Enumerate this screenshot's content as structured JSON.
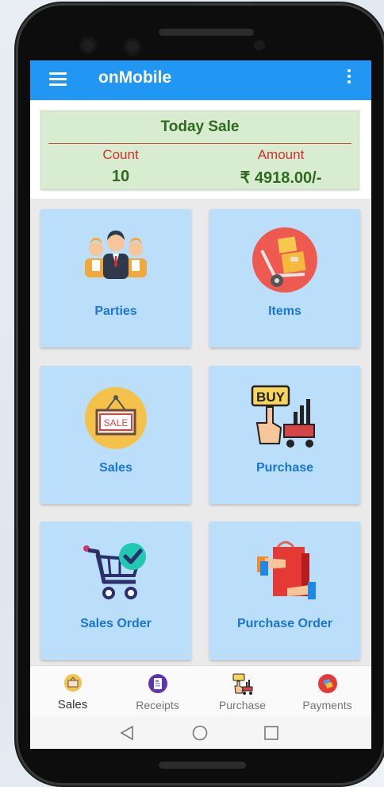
{
  "app": {
    "title": "onMobile",
    "primary_color": "#2196f3"
  },
  "summary": {
    "title": "Today Sale",
    "count_label": "Count",
    "amount_label": "Amount",
    "count_value": "10",
    "amount_value": "₹ 4918.00/-"
  },
  "tiles": [
    {
      "label": "Parties",
      "icon": "parties-icon"
    },
    {
      "label": "Items",
      "icon": "items-icon"
    },
    {
      "label": "Sales",
      "icon": "sales-icon"
    },
    {
      "label": "Purchase",
      "icon": "purchase-icon"
    },
    {
      "label": "Sales Order",
      "icon": "sales-order-icon"
    },
    {
      "label": "Purchase Order",
      "icon": "purchase-order-icon"
    }
  ],
  "bottom_nav": [
    {
      "label": "Sales",
      "active": true
    },
    {
      "label": "Receipts",
      "active": false
    },
    {
      "label": "Purchase",
      "active": false
    },
    {
      "label": "Payments",
      "active": false
    }
  ],
  "sale_sign_text": "SALE",
  "buy_sign_text": "BUY"
}
